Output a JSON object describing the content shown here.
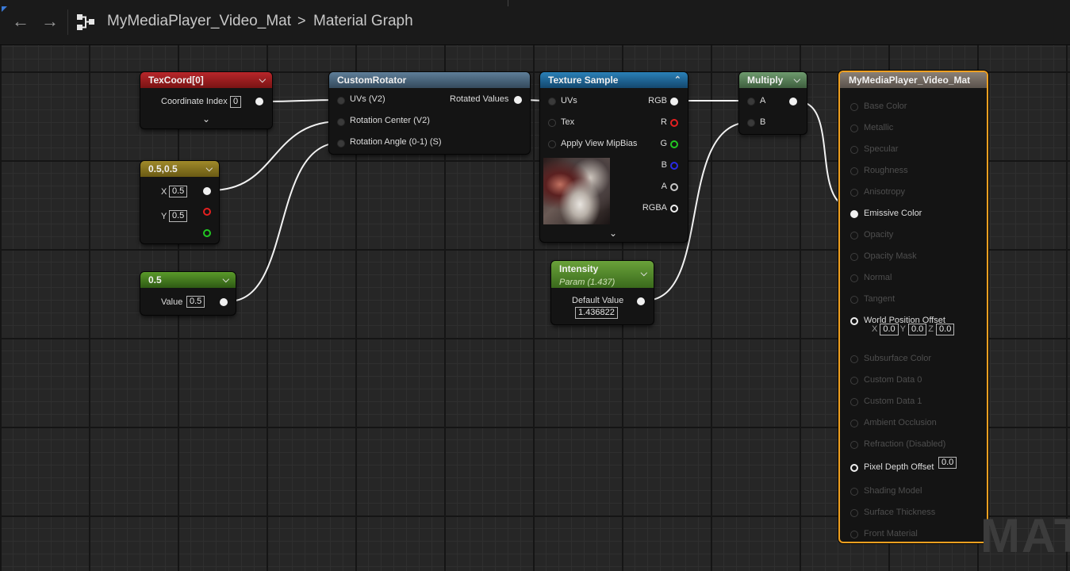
{
  "breadcrumb": {
    "asset": "MyMediaPlayer_Video_Mat",
    "separator": ">",
    "graph": "Material Graph"
  },
  "nodes": {
    "texcoord": {
      "title": "TexCoord[0]",
      "color": "#9a1c1c",
      "label": "Coordinate Index",
      "value": "0"
    },
    "vec2": {
      "title": "0.5,0.5",
      "color": "#8f7a1c",
      "x_label": "X",
      "x_value": "0.5",
      "y_label": "Y",
      "y_value": "0.5"
    },
    "scalar": {
      "title": "0.5",
      "color": "#4a7a1c",
      "label": "Value",
      "value": "0.5"
    },
    "rotator": {
      "title": "CustomRotator",
      "color": "#4c6c84",
      "inputs": [
        "UVs (V2)",
        "Rotation Center (V2)",
        "Rotation Angle (0-1) (S)"
      ],
      "output": "Rotated Values"
    },
    "texsample": {
      "title": "Texture Sample",
      "color": "#1f6a9a",
      "inputs": [
        "UVs",
        "Tex",
        "Apply View MipBias"
      ],
      "outputs": [
        "RGB",
        "R",
        "G",
        "B",
        "A",
        "RGBA"
      ]
    },
    "intensity": {
      "title": "Intensity",
      "subtitle": "Param (1.437)",
      "color": "#4c8a2c",
      "label": "Default Value",
      "value": "1.436822"
    },
    "multiply": {
      "title": "Multiply",
      "color": "#587a58",
      "inputs": [
        "A",
        "B"
      ]
    },
    "output": {
      "title": "MyMediaPlayer_Video_Mat",
      "accent": "#f0a020",
      "pins": [
        "Base Color",
        "Metallic",
        "Specular",
        "Roughness",
        "Anisotropy",
        "Emissive Color",
        "Opacity",
        "Opacity Mask",
        "Normal",
        "Tangent",
        "World Position Offset",
        "Subsurface Color",
        "Custom Data 0",
        "Custom Data 1",
        "Ambient Occlusion",
        "Refraction (Disabled)",
        "Pixel Depth Offset",
        "Shading Model",
        "Surface Thickness",
        "Front Material"
      ],
      "wpo": {
        "x_label": "X",
        "x": "0.0",
        "y_label": "Y",
        "y": "0.0",
        "z_label": "Z",
        "z": "0.0"
      },
      "pdo_value": "0.0"
    }
  },
  "watermark": "MAT"
}
